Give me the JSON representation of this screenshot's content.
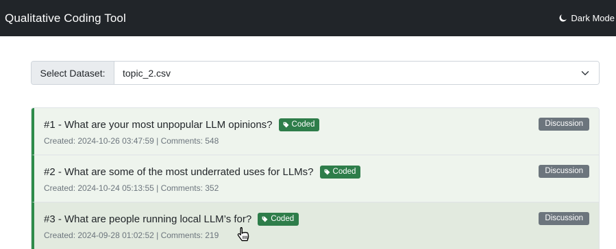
{
  "app": {
    "title": "Qualitative Coding Tool"
  },
  "header": {
    "dark_mode_label": "Dark Mode",
    "dark_mode_icon": "moon-icon"
  },
  "dataset": {
    "label": "Select Dataset:",
    "selected": "topic_2.csv"
  },
  "posts": [
    {
      "title": "#1 - What are your most unpopular LLM opinions?",
      "status": "Coded",
      "meta": "Created: 2024-10-26 03:47:59 | Comments: 548",
      "type": "Discussion"
    },
    {
      "title": "#2 - What are some of the most underrated uses for LLMs?",
      "status": "Coded",
      "meta": "Created: 2024-10-24 05:13:55 | Comments: 352",
      "type": "Discussion"
    },
    {
      "title": "#3 - What are people running local LLM’s for?",
      "status": "Coded",
      "meta": "Created: 2024-09-28 01:02:52 | Comments: 219",
      "type": "Discussion"
    }
  ],
  "colors": {
    "navbar": "#212529",
    "coded_badge": "#2e7d4a",
    "type_badge": "#6c757d",
    "item_accent": "#2e8b4a"
  }
}
